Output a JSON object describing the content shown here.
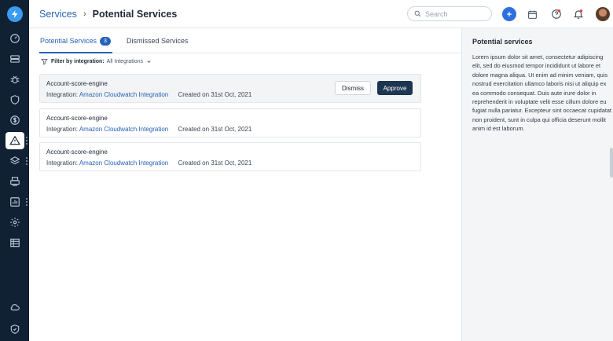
{
  "header": {
    "breadcrumb": {
      "parent": "Services",
      "separator": "›",
      "current": "Potential Services"
    },
    "search": {
      "placeholder": "Search",
      "value": ""
    }
  },
  "tabs": [
    {
      "label": "Potential Services",
      "count": "3",
      "active": true
    },
    {
      "label": "Dismissed Services",
      "active": false
    }
  ],
  "filter": {
    "label": "Filter by integration:",
    "value": "All Integrations"
  },
  "services": [
    {
      "name": "Account-score-engine",
      "integration_label": "Integration:",
      "integration": "Amazon Cloudwatch Integration",
      "created": "Created on 31st Oct, 2021"
    },
    {
      "name": "Account-score-engine",
      "integration_label": "Integration:",
      "integration": "Amazon Cloudwatch Integration",
      "created": "Created on 31st Oct, 2021"
    },
    {
      "name": "Account-score-engine",
      "integration_label": "Integration:",
      "integration": "Amazon Cloudwatch Integration",
      "created": "Created on 31st Oct, 2021"
    }
  ],
  "actions": {
    "dismiss": "Dismiss",
    "approve": "Approve"
  },
  "panel": {
    "title": "Potential services",
    "body": "Lorem ipsum dolor sit amet, consectetur adipiscing elit, sed do eiusmod tempor incididunt ut labore et dolore magna aliqua. Ut enim ad minim veniam, quis nostrud exercitation ullamco laboris nisi ut aliquip ex ea commodo consequat. Duis aute irure dolor in reprehenderit in voluptate velit esse cillum dolore eu fugiat nulla pariatur. Excepteur sint occaecat cupidatat non proident, sunt in culpa qui officia deserunt mollit anim id est laborum."
  },
  "icons": {
    "logo": "lightning-bolt-icon",
    "nav": [
      "gauge-icon",
      "server-icon",
      "bug-icon",
      "shield-icon",
      "dollar-icon",
      "alert-triangle-icon",
      "layers-icon",
      "printer-icon",
      "chart-icon",
      "gear-icon",
      "table-icon",
      "cloud-icon",
      "shield-check-icon"
    ],
    "header": [
      "search-icon",
      "plus-icon",
      "calendar-icon",
      "help-icon",
      "bell-icon"
    ]
  },
  "colors": {
    "sidebar": "#0f2133",
    "accent": "#2563b6",
    "approve": "#1c3550",
    "notification": "#e5483b"
  }
}
